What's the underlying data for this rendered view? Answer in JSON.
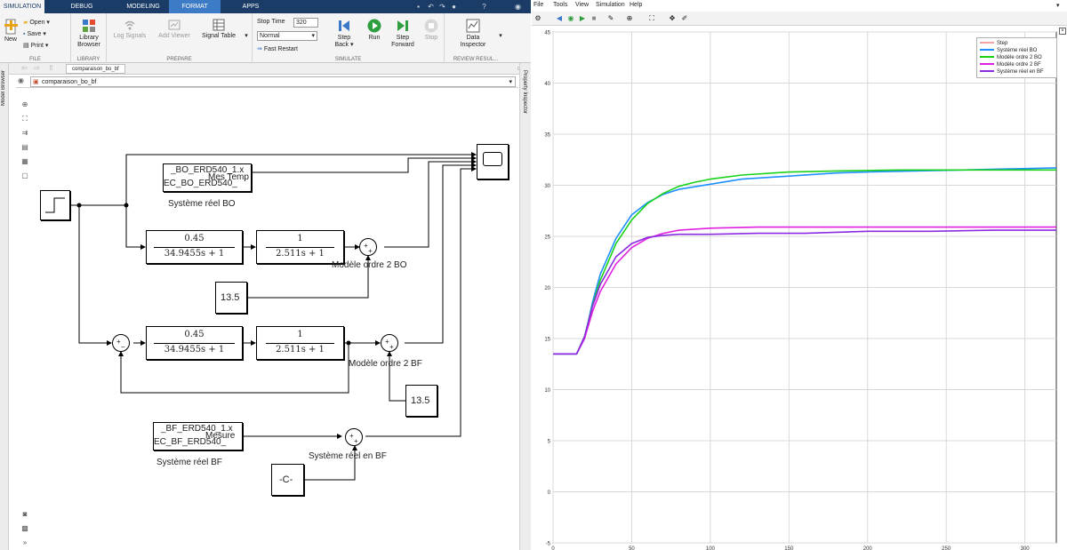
{
  "simulink": {
    "tabs": [
      "SIMULATION",
      "DEBUG",
      "MODELING",
      "FORMAT",
      "APPS"
    ],
    "active_tab": "SIMULATION",
    "file_group": {
      "new_label": "New",
      "open_label": "Open",
      "save_label": "Save",
      "print_label": "Print",
      "group": "FILE"
    },
    "library_group": {
      "library_browser_label": "Library Browser",
      "group": "LIBRARY"
    },
    "prepare_group": {
      "log_signals_label": "Log Signals",
      "add_viewer_label": "Add Viewer",
      "signal_table_label": "Signal Table",
      "group": "PREPARE"
    },
    "simulate_group": {
      "stop_time_label": "Stop Time",
      "stop_time_value": "320",
      "mode_value": "Normal",
      "fast_restart_label": "Fast Restart",
      "step_back_label": "Step Back",
      "run_label": "Run",
      "step_forward_label": "Step Forward",
      "stop_label": "Stop",
      "group": "SIMULATE"
    },
    "review_group": {
      "data_inspector_label": "Data Inspector",
      "group": "REVIEW RESUL..."
    },
    "model_tab": "comparaison_bo_bf",
    "address": "comparaison_bo_bf",
    "model_browser_label": "Model Browser",
    "property_inspector_label": "Property Inspector",
    "diagram": {
      "from_file_bo": {
        "line1": "_BO_ERD540_1.x",
        "line2": "EC_BO_ERD540_",
        "port_label": "Mes Temp",
        "caption": "Système réel BO"
      },
      "tf1": {
        "num": "0.45",
        "den": "34.9455s + 1"
      },
      "tf2": {
        "num": "1",
        "den": "2.511s + 1"
      },
      "tf3": {
        "num": "0.45",
        "den": "34.9455s + 1"
      },
      "tf4": {
        "num": "1",
        "den": "2.511s + 1"
      },
      "sum_bo_caption": "Modèle ordre 2 BO",
      "sum_bf_caption": "Modèle ordre 2 BF",
      "const1": "13.5",
      "const2": "13.5",
      "from_file_bf": {
        "line1": "_BF_ERD540_1.x",
        "line2": "EC_BF_ERD540_",
        "port_label": "Mesure",
        "caption": "Système réel BF"
      },
      "sum_real_bf_caption": "Système réel en BF",
      "const_c": "-C-"
    }
  },
  "scope": {
    "menu": [
      "File",
      "Tools",
      "View",
      "Simulation",
      "Help"
    ],
    "legend_entries": [
      {
        "name": "Step",
        "color": "#f4a6a6"
      },
      {
        "name": "Système réel BO",
        "color": "#1e90ff"
      },
      {
        "name": "Modèle ordre 2 BO",
        "color": "#19d219"
      },
      {
        "name": "Modèle ordre 2 BF",
        "color": "#e01fe0"
      },
      {
        "name": "Système réel en BF",
        "color": "#8a2be2"
      }
    ]
  },
  "chart_data": {
    "type": "line",
    "xlim": [
      0,
      320
    ],
    "ylim": [
      -5,
      45
    ],
    "xticks": [
      0,
      50,
      100,
      150,
      200,
      250,
      300
    ],
    "yticks": [
      -5,
      0,
      5,
      10,
      15,
      20,
      25,
      30,
      35,
      40,
      45
    ],
    "grid": true,
    "legend_position": "top-right",
    "series": [
      {
        "name": "Système réel BO",
        "color": "#1e90ff",
        "x": [
          0,
          10,
          15,
          20,
          25,
          30,
          40,
          50,
          60,
          70,
          80,
          100,
          120,
          150,
          180,
          200,
          230,
          260,
          290,
          320
        ],
        "y": [
          13.5,
          13.5,
          13.5,
          15,
          18.5,
          21.3,
          24.8,
          27.1,
          28.3,
          29.1,
          29.6,
          30.1,
          30.6,
          30.9,
          31.2,
          31.3,
          31.4,
          31.5,
          31.6,
          31.7
        ]
      },
      {
        "name": "Modèle ordre 2 BO",
        "color": "#19d219",
        "x": [
          0,
          15,
          20,
          25,
          30,
          40,
          50,
          60,
          70,
          80,
          90,
          100,
          120,
          150,
          180,
          220,
          260,
          320
        ],
        "y": [
          13.5,
          13.5,
          15.2,
          18.2,
          20.7,
          24.3,
          26.6,
          28.2,
          29.2,
          29.9,
          30.3,
          30.6,
          31.0,
          31.3,
          31.4,
          31.5,
          31.5,
          31.5
        ]
      },
      {
        "name": "Modèle ordre 2 BF",
        "color": "#e01fe0",
        "x": [
          0,
          15,
          20,
          25,
          30,
          40,
          50,
          60,
          70,
          80,
          100,
          130,
          160,
          200,
          260,
          320
        ],
        "y": [
          13.5,
          13.5,
          15,
          17.6,
          19.6,
          22.3,
          23.9,
          24.8,
          25.3,
          25.6,
          25.8,
          25.9,
          25.9,
          25.9,
          25.9,
          25.9
        ]
      },
      {
        "name": "Système réel en BF",
        "color": "#8a2be2",
        "x": [
          0,
          10,
          15,
          20,
          25,
          30,
          40,
          50,
          60,
          70,
          80,
          100,
          130,
          160,
          180,
          200,
          240,
          280,
          320
        ],
        "y": [
          13.5,
          13.5,
          13.5,
          15.2,
          18.1,
          20.3,
          23.0,
          24.3,
          24.9,
          25.1,
          25.2,
          25.2,
          25.3,
          25.3,
          25.4,
          25.5,
          25.5,
          25.6,
          25.6
        ]
      }
    ]
  }
}
